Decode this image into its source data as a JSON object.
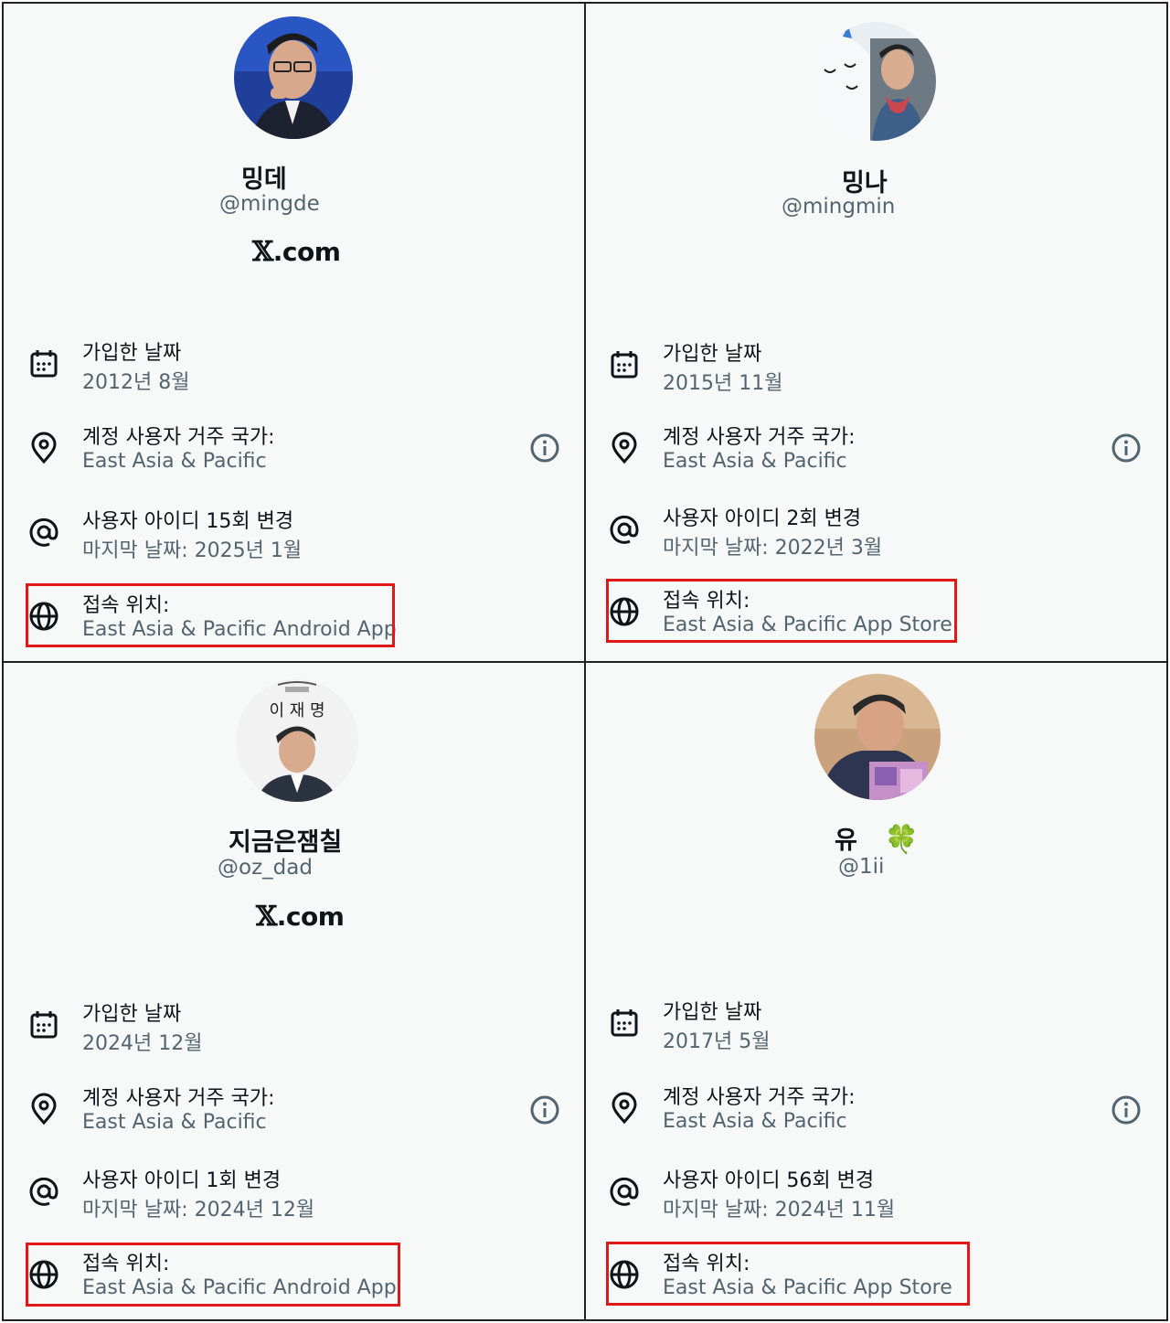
{
  "panels": [
    {
      "name": "밍데",
      "handle": "@mingde",
      "site": "X.com",
      "joined_label": "가입한 날짜",
      "joined_value": "2012년 8월",
      "country_label": "계정 사용자 거주 국가:",
      "country_value": "East Asia & Pacific",
      "username_label": "사용자 아이디 15회 변경",
      "username_value": "마지막 날짜: 2025년 1월",
      "connect_label": "접속 위치:",
      "connect_value": "East Asia & Pacific Android App"
    },
    {
      "name": "밍나",
      "handle": "@mingmin",
      "joined_label": "가입한 날짜",
      "joined_value": "2015년 11월",
      "country_label": "계정 사용자 거주 국가:",
      "country_value": "East Asia & Pacific",
      "username_label": "사용자 아이디 2회 변경",
      "username_value": "마지막 날짜: 2022년 3월",
      "connect_label": "접속 위치:",
      "connect_value": "East Asia & Pacific App Store"
    },
    {
      "name": "지금은잼칠",
      "handle": "@oz_dad",
      "site": "X.com",
      "avatar_text": "이 재 명",
      "joined_label": "가입한 날짜",
      "joined_value": "2024년 12월",
      "country_label": "계정 사용자 거주 국가:",
      "country_value": "East Asia & Pacific",
      "username_label": "사용자 아이디 1회 변경",
      "username_value": "마지막 날짜: 2024년 12월",
      "connect_label": "접속 위치:",
      "connect_value": "East Asia & Pacific Android App"
    },
    {
      "name": "유",
      "emoji": "🍀",
      "handle": "@1ii",
      "joined_label": "가입한 날짜",
      "joined_value": "2017년 5월",
      "country_label": "계정 사용자 거주 국가:",
      "country_value": "East Asia & Pacific",
      "username_label": "사용자 아이디 56회 변경",
      "username_value": "마지막 날짜: 2024년 11월",
      "connect_label": "접속 위치:",
      "connect_value": "East Asia & Pacific App Store"
    }
  ],
  "icons": {
    "calendar": "calendar-icon",
    "location": "location-pin-icon",
    "username": "at-sign-icon",
    "connect": "globe-icon",
    "info": "info-icon"
  },
  "colors": {
    "highlight": "#e01818",
    "secondary_text": "#536471",
    "primary_text": "#0f1419"
  }
}
